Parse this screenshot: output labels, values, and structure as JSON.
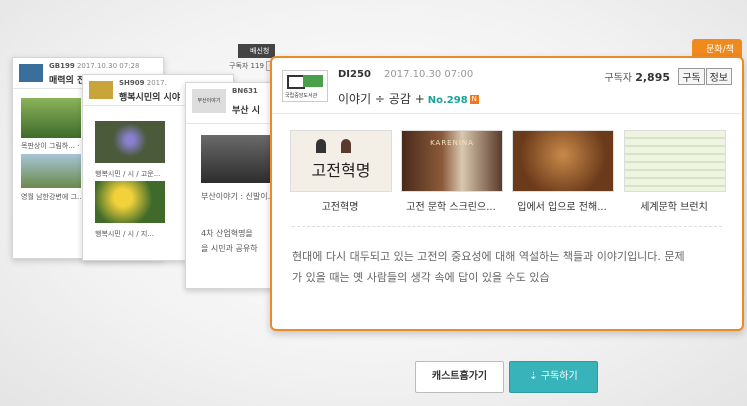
{
  "back_cards": [
    {
      "id": "GB199",
      "date": "2017.10.30 07:28",
      "title": "매력의 전",
      "caps": [
        "목판상이 그림하... ·",
        "영월 남한강변에 그..."
      ]
    },
    {
      "id": "SH909",
      "date": "2017.",
      "title": "행복시민의 시야",
      "caps": [
        "행복시민 / 시 / 고운...",
        "행복시민 / 시 / 지..."
      ]
    },
    {
      "id": "BN631",
      "date": "",
      "title": "부산 시",
      "logo_text": "부산이야기",
      "caps": [
        "부산이야기 : 신발이...",
        "4차 산업혁명을",
        "을 시민과 공유하"
      ]
    }
  ],
  "card2_subs": "구독자 119",
  "card2_pill": "구독",
  "tag_dark": "배신청",
  "tag_category": "문화/책",
  "main": {
    "logo_text": "국립중앙도서관",
    "id": "DI250",
    "date": "2017.10.30 07:00",
    "subs_label": "구독자",
    "subs_count": "2,895",
    "subscribe": "구독",
    "info": "정보",
    "title": "이야기 ÷ 공감 +",
    "no": "No.298",
    "new": "N",
    "items": [
      "고전혁명",
      "고전 문학 스크린으...",
      "입에서 입으로 전해...",
      "세계문학 브런치"
    ],
    "item1_cover_text": "고전혁명",
    "item2_cover_text": "KARENINA",
    "description": "현대에 다시 대두되고 있는 고전의 중요성에 대해 역설하는 책들과 이야기입니다. 문제가 있을 때는 옛 사람들의 생각 속에 답이 있을 수도 있습"
  },
  "buttons": {
    "home": "캐스트홈가기",
    "subscribe": "구독하기"
  },
  "colors": {
    "accent_orange": "#ea8a28",
    "teal": "#37b3b9",
    "no_green": "#19a39a"
  }
}
